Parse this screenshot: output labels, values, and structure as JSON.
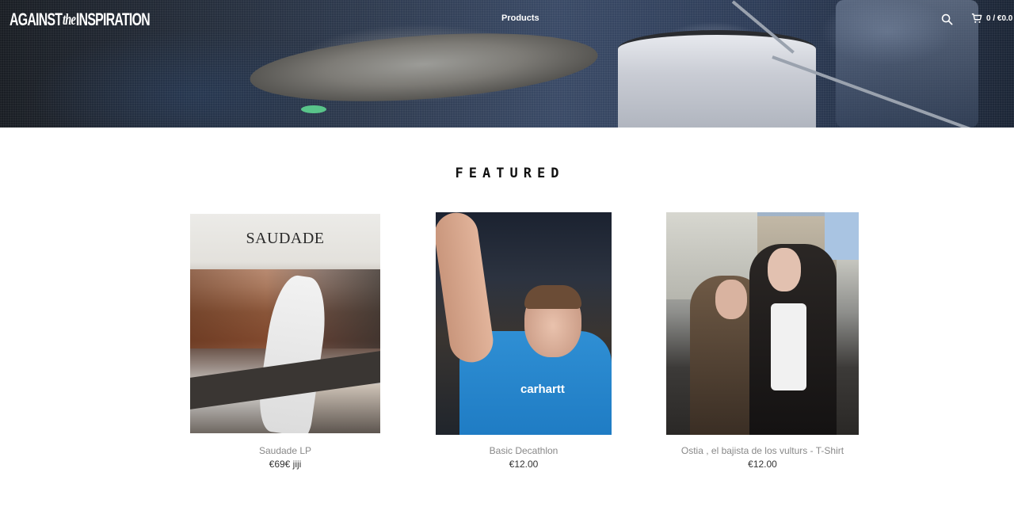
{
  "header": {
    "logo": {
      "word1": "AGAINST",
      "word2": "the",
      "word3": "INSPIRATION"
    },
    "nav": {
      "products": "Products"
    },
    "cart": {
      "total": "0 / €0.0"
    },
    "icons": {
      "search": "search-icon",
      "cart": "cart-icon"
    }
  },
  "featured": {
    "title": "FEATURED",
    "products": [
      {
        "name": "Saudade LP",
        "price": "€69€ jiji",
        "art_text": "SAUDADE"
      },
      {
        "name": "Basic Decathlon",
        "price": "€12.00",
        "shirt_text": "carhartt"
      },
      {
        "name": "Ostia , el bajista de los vulturs - T-Shirt",
        "price": "€12.00"
      }
    ]
  }
}
